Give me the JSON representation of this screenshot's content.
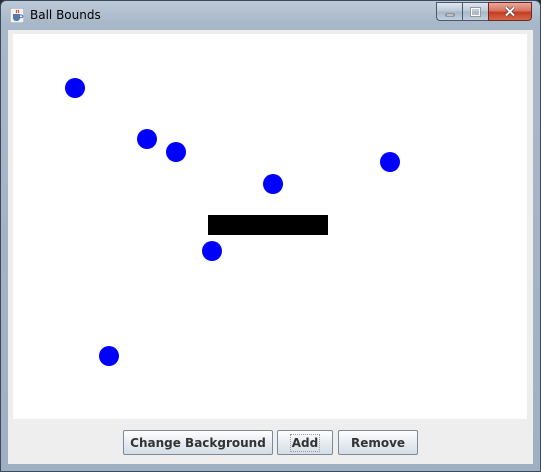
{
  "window": {
    "title": "Ball Bounds",
    "title_icon": "java-cup-icon"
  },
  "caption_buttons": [
    "minimize-icon",
    "maximize-icon",
    "close-icon"
  ],
  "canvas": {
    "background": "#ffffff",
    "ball_color": "#0000ff",
    "paddle_color": "#000000"
  },
  "controls": {
    "change_background_label": "Change Background",
    "add_label": "Add",
    "remove_label": "Remove"
  }
}
